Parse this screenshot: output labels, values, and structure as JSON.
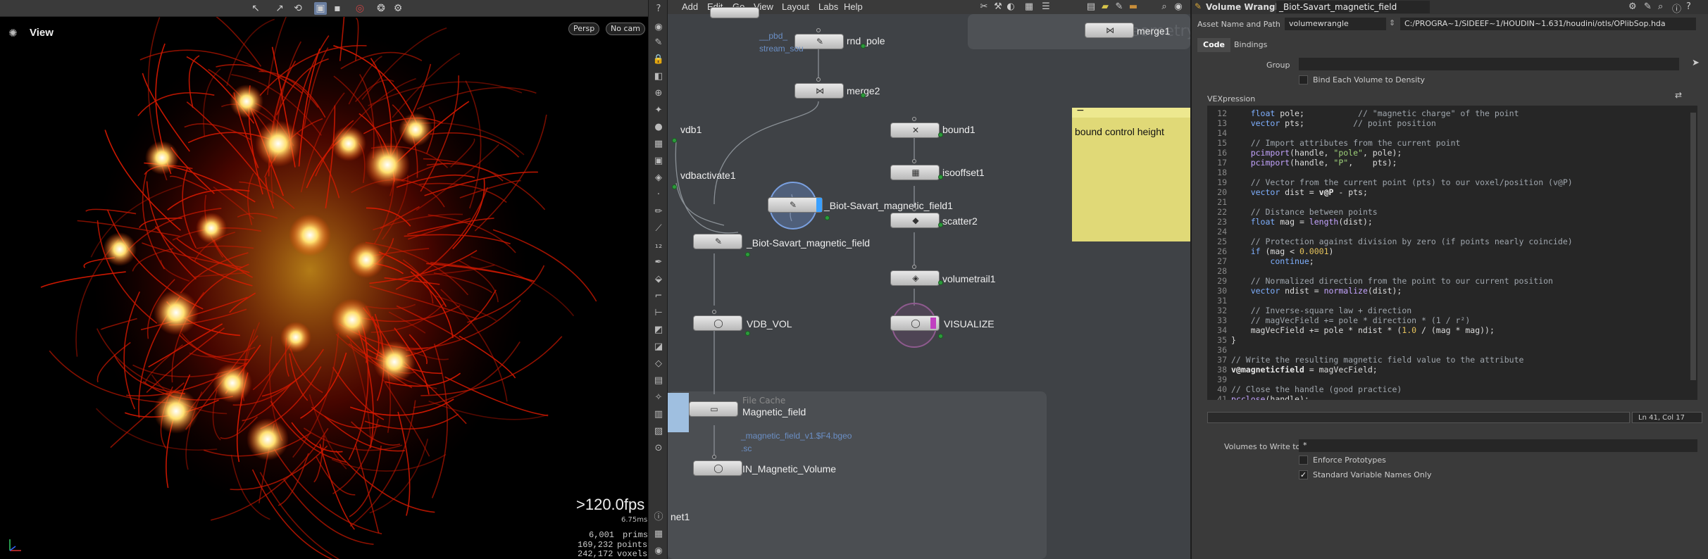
{
  "viewport": {
    "title": "View",
    "persp": "Persp",
    "nocam": "No cam",
    "fps": ">120.0fps",
    "ms": "6.75ms",
    "stats": [
      {
        "value": "6,001",
        "unit": "prims"
      },
      {
        "value": "169,232",
        "unit": "points"
      },
      {
        "value": "242,172",
        "unit": "voxels"
      }
    ]
  },
  "network": {
    "menu": [
      "Add",
      "Edit",
      "Go",
      "View",
      "Layout",
      "Labs",
      "Help"
    ],
    "watermark": "Geometry",
    "nodes": {
      "rnd_pole": "rnd_pole",
      "pbd_sub": "__pbd_",
      "stream_sub": "stream_sou",
      "merge2": "merge2",
      "merge1": "merge1",
      "vdb1": "vdb1",
      "bound1": "bound1",
      "vdbactivate1": "vdbactivate1",
      "isooffset1": "isooffset1",
      "biot_field1": "_Biot-Savart_magnetic_field1",
      "biot_field": "_Biot-Savart_magnetic_field",
      "scatter2": "scatter2",
      "volumetrail1": "volumetrail1",
      "vdb_vol": "VDB_VOL",
      "visualize": "VISUALIZE",
      "file_cache_type": "File Cache",
      "magnetic_field": "Magnetic_field",
      "cache_path": "_magnetic_field_v1.$F4.bgeo",
      "cache_sub": ".sc",
      "in_volume": "IN_Magnetic_Volume",
      "net1": "net1"
    },
    "sticky_note": "bound control height"
  },
  "params": {
    "node_type": "Volume Wrangle",
    "node_name": "_Biot-Savart_magnetic_field",
    "asset_label": "Asset Name and Path",
    "asset_name": "volumewrangle",
    "asset_path": "C:/PROGRA~1/SIDEEF~1/HOUDIN~1.631/houdini/otls/OPlibSop.hda",
    "tabs": [
      "Code",
      "Bindings"
    ],
    "group_label": "Group",
    "bind_each": "Bind Each Volume to Density",
    "vexpression_label": "VEXpression",
    "status": "Ln 41, Col 17",
    "volumes_label": "Volumes to Write to",
    "volumes_value": "*",
    "enforce": "Enforce Prototypes",
    "standard": "Standard Variable Names Only"
  },
  "code_lines": [
    {
      "n": "12",
      "parts": [
        {
          "t": "    "
        },
        {
          "c": "kw",
          "t": "float"
        },
        {
          "t": " pole;           "
        },
        {
          "c": "cm",
          "t": "// \"magnetic charge\" of the point"
        }
      ]
    },
    {
      "n": "13",
      "parts": [
        {
          "t": "    "
        },
        {
          "c": "kw",
          "t": "vector"
        },
        {
          "t": " pts;          "
        },
        {
          "c": "cm",
          "t": "// point position"
        }
      ]
    },
    {
      "n": "14",
      "parts": [
        {
          "t": ""
        }
      ]
    },
    {
      "n": "15",
      "parts": [
        {
          "t": "    "
        },
        {
          "c": "cm",
          "t": "// Import attributes from the current point"
        }
      ]
    },
    {
      "n": "16",
      "parts": [
        {
          "t": "    "
        },
        {
          "c": "fn",
          "t": "pcimport"
        },
        {
          "t": "(handle, "
        },
        {
          "c": "str",
          "t": "\"pole\""
        },
        {
          "t": ", pole);"
        }
      ]
    },
    {
      "n": "17",
      "parts": [
        {
          "t": "    "
        },
        {
          "c": "fn",
          "t": "pcimport"
        },
        {
          "t": "(handle, "
        },
        {
          "c": "str",
          "t": "\"P\""
        },
        {
          "t": ",    pts);"
        }
      ]
    },
    {
      "n": "18",
      "parts": [
        {
          "t": ""
        }
      ]
    },
    {
      "n": "19",
      "parts": [
        {
          "t": "    "
        },
        {
          "c": "cm",
          "t": "// Vector from the current point (pts) to our voxel/position (v@P)"
        }
      ]
    },
    {
      "n": "20",
      "parts": [
        {
          "t": "    "
        },
        {
          "c": "kw",
          "t": "vector"
        },
        {
          "t": " dist = "
        },
        {
          "c": "vv",
          "t": "v@P"
        },
        {
          "t": " - pts;"
        }
      ]
    },
    {
      "n": "21",
      "parts": [
        {
          "t": ""
        }
      ]
    },
    {
      "n": "22",
      "parts": [
        {
          "t": "    "
        },
        {
          "c": "cm",
          "t": "// Distance between points"
        }
      ]
    },
    {
      "n": "23",
      "parts": [
        {
          "t": "    "
        },
        {
          "c": "kw",
          "t": "float"
        },
        {
          "t": " mag = "
        },
        {
          "c": "fn",
          "t": "length"
        },
        {
          "t": "(dist);"
        }
      ]
    },
    {
      "n": "24",
      "parts": [
        {
          "t": ""
        }
      ]
    },
    {
      "n": "25",
      "parts": [
        {
          "t": "    "
        },
        {
          "c": "cm",
          "t": "// Protection against division by zero (if points nearly coincide)"
        }
      ]
    },
    {
      "n": "26",
      "parts": [
        {
          "t": "    "
        },
        {
          "c": "kw",
          "t": "if"
        },
        {
          "t": " (mag < "
        },
        {
          "c": "num",
          "t": "0.0001"
        },
        {
          "t": ")"
        }
      ]
    },
    {
      "n": "27",
      "parts": [
        {
          "t": "        "
        },
        {
          "c": "kw",
          "t": "continue"
        },
        {
          "t": ";"
        }
      ]
    },
    {
      "n": "28",
      "parts": [
        {
          "t": ""
        }
      ]
    },
    {
      "n": "29",
      "parts": [
        {
          "t": "    "
        },
        {
          "c": "cm",
          "t": "// Normalized direction from the point to our current position"
        }
      ]
    },
    {
      "n": "30",
      "parts": [
        {
          "t": "    "
        },
        {
          "c": "kw",
          "t": "vector"
        },
        {
          "t": " ndist = "
        },
        {
          "c": "fn",
          "t": "normalize"
        },
        {
          "t": "(dist);"
        }
      ]
    },
    {
      "n": "31",
      "parts": [
        {
          "t": ""
        }
      ]
    },
    {
      "n": "32",
      "parts": [
        {
          "t": "    "
        },
        {
          "c": "cm",
          "t": "// Inverse-square law + direction"
        }
      ]
    },
    {
      "n": "33",
      "parts": [
        {
          "t": "    "
        },
        {
          "c": "cm",
          "t": "// magVecField += pole * direction * (1 / r²)"
        }
      ]
    },
    {
      "n": "34",
      "parts": [
        {
          "t": "    magVecField += pole * ndist * ("
        },
        {
          "c": "num",
          "t": "1.0"
        },
        {
          "t": " / (mag * mag));"
        }
      ]
    },
    {
      "n": "35",
      "parts": [
        {
          "t": "}"
        }
      ]
    },
    {
      "n": "36",
      "parts": [
        {
          "t": ""
        }
      ]
    },
    {
      "n": "37",
      "parts": [
        {
          "c": "cm",
          "t": "// Write the resulting magnetic field value to the attribute"
        }
      ]
    },
    {
      "n": "38",
      "parts": [
        {
          "c": "vv",
          "t": "v@magneticfield"
        },
        {
          "t": " = magVecField;"
        }
      ]
    },
    {
      "n": "39",
      "parts": [
        {
          "t": ""
        }
      ]
    },
    {
      "n": "40",
      "parts": [
        {
          "c": "cm",
          "t": "// Close the handle (good practice)"
        }
      ]
    },
    {
      "n": "41",
      "parts": [
        {
          "c": "fn",
          "t": "pcclose"
        },
        {
          "t": "(handle);"
        }
      ]
    }
  ]
}
